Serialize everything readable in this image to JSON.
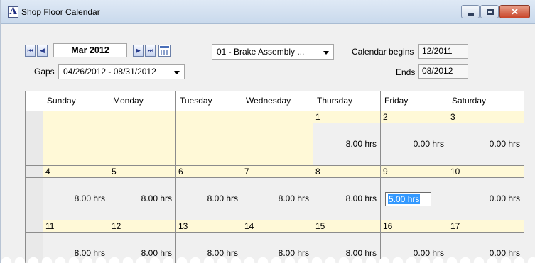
{
  "window": {
    "title": "Shop Floor Calendar",
    "app_icon_glyph": "Λ",
    "controls": {
      "minimize": "minimize-icon",
      "maximize": "maximize-icon",
      "close": "close-icon",
      "close_glyph": "✕"
    }
  },
  "toolbar": {
    "first_glyph": "⏮",
    "prev_glyph": "◀",
    "next_glyph": "▶",
    "last_glyph": "⏭",
    "month": "Mar 2012",
    "calendar_icon": "calendar-icon",
    "gaps_label": "Gaps",
    "gaps_value": "04/26/2012 - 08/31/2012",
    "department_value": "01 - Brake Assembly ...",
    "calendar_begins_label": "Calendar begins",
    "calendar_begins_value": "12/2011",
    "ends_label": "Ends",
    "ends_value": "08/2012"
  },
  "calendar": {
    "days": [
      "Sunday",
      "Monday",
      "Tuesday",
      "Wednesday",
      "Thursday",
      "Friday",
      "Saturday"
    ],
    "weeks": [
      {
        "dates": [
          "",
          "",
          "",
          "",
          "1",
          "2",
          "3"
        ],
        "hours": [
          "",
          "",
          "",
          "",
          "8.00 hrs",
          "0.00 hrs",
          "0.00 hrs"
        ]
      },
      {
        "dates": [
          "4",
          "5",
          "6",
          "7",
          "8",
          "9",
          "10"
        ],
        "hours": [
          "8.00 hrs",
          "8.00 hrs",
          "8.00 hrs",
          "8.00 hrs",
          "8.00 hrs",
          "5.00 hrs",
          "0.00 hrs"
        ]
      },
      {
        "dates": [
          "11",
          "12",
          "13",
          "14",
          "15",
          "16",
          "17"
        ],
        "hours": [
          "8.00 hrs",
          "8.00 hrs",
          "8.00 hrs",
          "8.00 hrs",
          "8.00 hrs",
          "0.00 hrs",
          "0.00 hrs"
        ]
      }
    ],
    "selected_cell": {
      "week": 1,
      "day": 5
    },
    "colors": {
      "outside_month": "#fff9d7",
      "inside_month": "#f0f0f0",
      "selection": "#3399ff"
    }
  }
}
